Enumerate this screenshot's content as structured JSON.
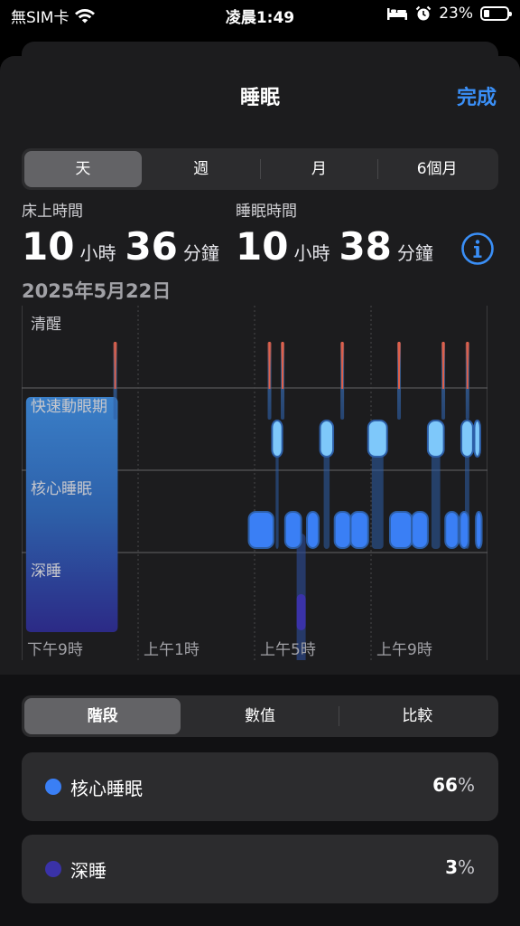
{
  "status_bar": {
    "carrier": "無SIM卡",
    "time": "凌晨1:49",
    "battery": "23%",
    "battery_level": 0.23
  },
  "nav": {
    "title": "睡眠",
    "done": "完成"
  },
  "period_tabs": [
    "天",
    "週",
    "月",
    "6個月"
  ],
  "period_selected": "天",
  "stats": {
    "in_bed": {
      "label": "床上時間",
      "hours": "10",
      "hours_unit": "小時",
      "minutes": "36",
      "minutes_unit": "分鐘"
    },
    "asleep": {
      "label": "睡眠時間",
      "hours": "10",
      "hours_unit": "小時",
      "minutes": "38",
      "minutes_unit": "分鐘"
    },
    "date": "2025年5月22日"
  },
  "chart_data": {
    "type": "hypnogram",
    "y_categories": [
      "清醒",
      "快速動眼期",
      "核心睡眠",
      "深睡"
    ],
    "x_tick_labels": [
      "下午9時",
      "上午1時",
      "上午5時",
      "上午9時"
    ],
    "x_ticks_hours": [
      0,
      4,
      8,
      12
    ],
    "x_range_hours": [
      0,
      16
    ],
    "colors": {
      "awake": "#e0604a",
      "rem": "#7ec8fa",
      "core": "#3a7ff5",
      "deep": "#3a32a8"
    },
    "segments": [
      {
        "stage": "核心睡眠",
        "start": 0.15,
        "end": 3.3,
        "tall": true
      },
      {
        "stage": "清醒",
        "start": 3.15,
        "end": 3.25
      },
      {
        "stage": "核心睡眠",
        "start": 7.8,
        "end": 8.65
      },
      {
        "stage": "清醒",
        "start": 8.45,
        "end": 8.55
      },
      {
        "stage": "快速動眼期",
        "start": 8.6,
        "end": 8.95
      },
      {
        "stage": "清醒",
        "start": 8.9,
        "end": 9.0
      },
      {
        "stage": "核心睡眠",
        "start": 9.05,
        "end": 9.6
      },
      {
        "stage": "深睡",
        "start": 9.45,
        "end": 9.75
      },
      {
        "stage": "核心睡眠",
        "start": 9.8,
        "end": 10.2
      },
      {
        "stage": "快速動眼期",
        "start": 10.25,
        "end": 10.7
      },
      {
        "stage": "核心睡眠",
        "start": 10.75,
        "end": 11.3
      },
      {
        "stage": "清醒",
        "start": 10.95,
        "end": 11.05
      },
      {
        "stage": "核心睡眠",
        "start": 11.3,
        "end": 11.9
      },
      {
        "stage": "快速動眼期",
        "start": 11.9,
        "end": 12.55
      },
      {
        "stage": "核心睡眠",
        "start": 12.65,
        "end": 13.4
      },
      {
        "stage": "清醒",
        "start": 12.9,
        "end": 13.0
      },
      {
        "stage": "核心睡眠",
        "start": 13.4,
        "end": 13.95
      },
      {
        "stage": "快速動眼期",
        "start": 13.95,
        "end": 14.5
      },
      {
        "stage": "核心睡眠",
        "start": 14.55,
        "end": 15.0
      },
      {
        "stage": "清醒",
        "start": 14.42,
        "end": 14.52
      },
      {
        "stage": "核心睡眠",
        "start": 15.05,
        "end": 15.35
      },
      {
        "stage": "快速動眼期",
        "start": 15.1,
        "end": 15.5
      },
      {
        "stage": "清醒",
        "start": 15.25,
        "end": 15.35
      },
      {
        "stage": "快速動眼期",
        "start": 15.55,
        "end": 15.75
      },
      {
        "stage": "核心睡眠",
        "start": 15.6,
        "end": 15.8
      }
    ]
  },
  "detail_tabs": [
    "階段",
    "數值",
    "比較"
  ],
  "detail_selected": "階段",
  "legend": [
    {
      "name": "核心睡眠",
      "value": "66",
      "unit": "%",
      "color": "#3a7ff5"
    },
    {
      "name": "深睡",
      "value": "3",
      "unit": "%",
      "color": "#3a32a8"
    }
  ]
}
